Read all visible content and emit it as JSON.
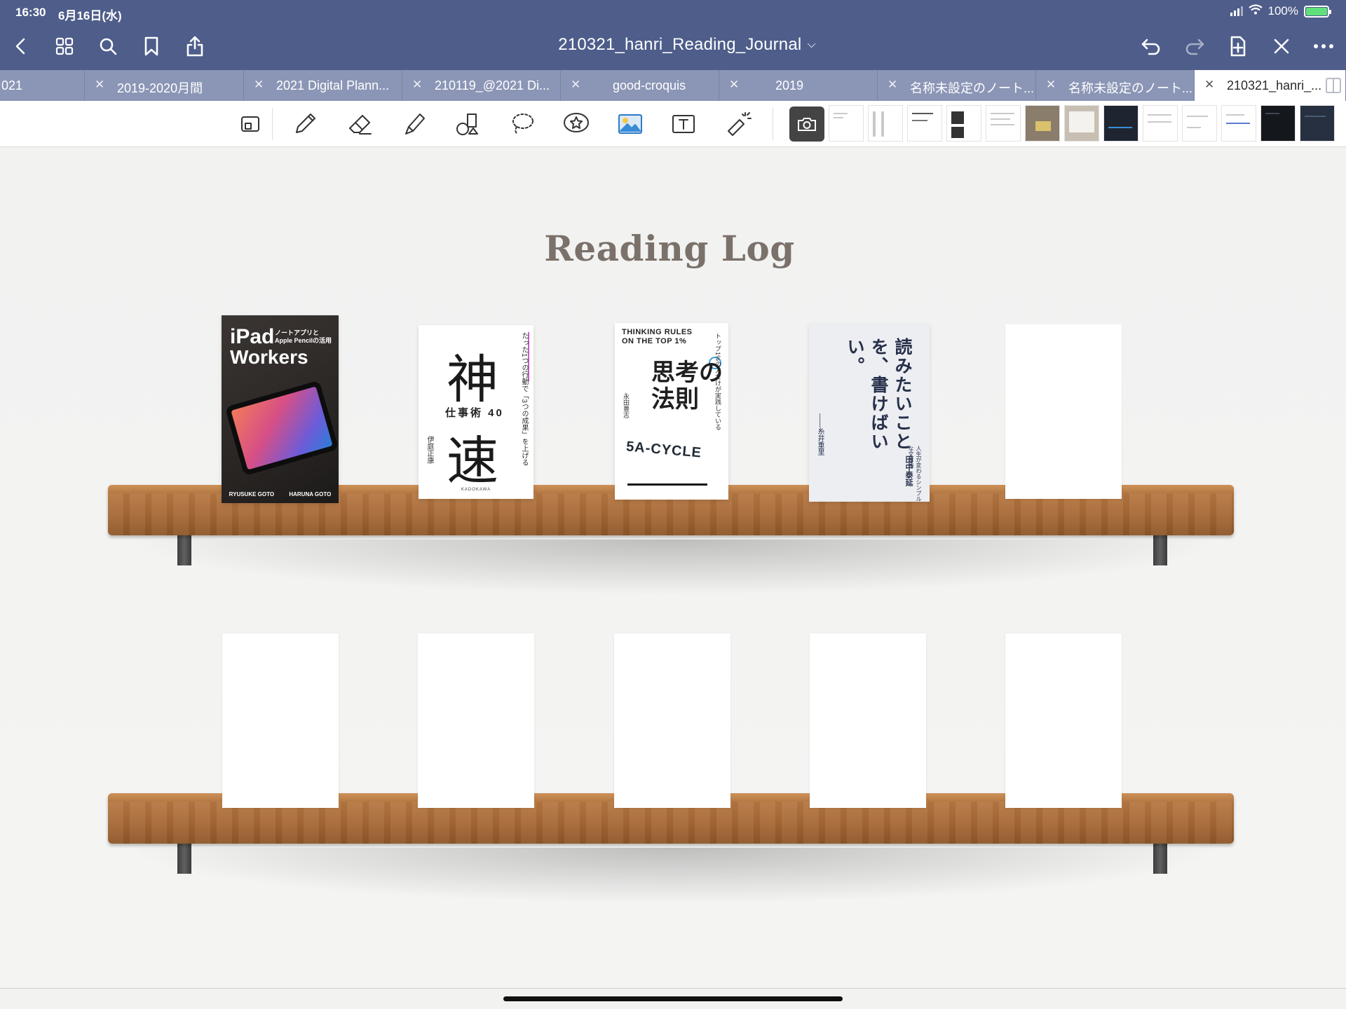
{
  "status_bar": {
    "time": "16:30",
    "date": "6月16日(水)",
    "battery": "100%"
  },
  "nav": {
    "title": "210321_hanri_Reading_Journal",
    "icons": [
      "chevron-left-icon",
      "grid-icon",
      "search-icon",
      "bookmark-icon",
      "share-icon",
      "undo-icon",
      "redo-icon",
      "add-page-icon",
      "close-icon",
      "more-icon"
    ]
  },
  "tabs": [
    {
      "label": "021",
      "active": false
    },
    {
      "label": "2019-2020月間",
      "active": false
    },
    {
      "label": "2021 Digital Plann...",
      "active": false
    },
    {
      "label": "210119_@2021 Di...",
      "active": false
    },
    {
      "label": "good-croquis",
      "active": false
    },
    {
      "label": "2019",
      "active": false
    },
    {
      "label": "名称未設定のノート...",
      "active": false
    },
    {
      "label": "名称未設定のノート...",
      "active": false
    },
    {
      "label": "210321_hanri_...",
      "active": true
    }
  ],
  "toolbar": {
    "tools": [
      "read-only-icon",
      "pen-icon",
      "eraser-icon",
      "highlighter-icon",
      "shapes-icon",
      "lasso-icon",
      "elements-icon",
      "image-icon",
      "text-icon",
      "laser-pointer-icon",
      "camera-icon"
    ]
  },
  "canvas": {
    "title": "Reading Log",
    "books": [
      {
        "id": "ipad-workers",
        "title_line1": "iPad",
        "title_line2": "Workers",
        "subtitle_line1": "ノートアプリと",
        "subtitle_line2": "Apple Pencilの活用",
        "author_left": "RYUSUKE GOTO",
        "author_right": "HARUNA GOTO"
      },
      {
        "id": "shinsoku",
        "kanji_top": "神",
        "kanji_bottom": "速",
        "middle": "仕事術 40",
        "tagline": "たった1つの行動で「3つの成果」を上げる",
        "author": "伊庭正康",
        "publisher": "KADOKAWA"
      },
      {
        "id": "shikou-no-housoku",
        "en_line1": "THINKING RULES",
        "en_line2": "ON THE TOP 1%",
        "title_line1": "思考の",
        "title_line2": "法則",
        "cycle": "5A-CYCLE",
        "tagline": "トップ1%の人だけが実践している",
        "author": "永田豊志"
      },
      {
        "id": "yomitai",
        "title": "読みたいことを、書けばいい。",
        "subtitle": "人生が変わるシンプルな文章術",
        "author": "田中泰延",
        "blurb": "――糸井重里"
      }
    ]
  }
}
